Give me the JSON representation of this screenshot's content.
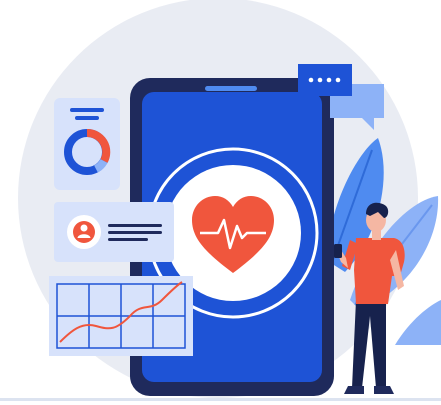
{
  "illustration": {
    "subject": "mobile-health-app",
    "icons": [
      "heart-icon",
      "pulse-icon",
      "donut-chart-icon",
      "user-avatar-icon",
      "chat-bubble-icon",
      "line-graph-icon",
      "leaf-icon"
    ],
    "colors": {
      "background_circle": "#E9ECF3",
      "phone_frame": "#1F2A5C",
      "phone_screen": "#1E53D6",
      "heart": "#F0563D",
      "card_light": "#D7E2FB",
      "accent_blue": "#4F8BF0",
      "shirt": "#F0563D",
      "pants": "#17224D"
    }
  }
}
